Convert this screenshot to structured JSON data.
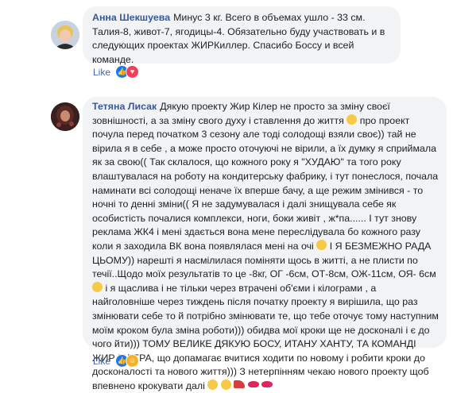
{
  "comments": [
    {
      "author": "Анна Шекшуева",
      "text": "Минус 3 кг. Всего в объемах ушло - 33 см. Талия-8, живот-7, ягодицы-4. Обязательно буду участвовать и в следующих проектах ЖИРКиллер. Спасибо Боссу и всей команде.",
      "action": "Like",
      "reactions": [
        "like",
        "love"
      ]
    },
    {
      "author": "Тетяна Лисак",
      "text_part1": "Дякую проекту Жир Кілер не просто за зміну своєї зовнішності, а за зміну свого духу і ставлення до життя",
      "text_part2": "про проект почула перед початком 3 сезону але тоді солодощі взяли своє)) тай не вірила я в себе , а може просто оточуючі не вірили, а їх думку я сприймала як за свою(( Так склалося, що кожного року я \"ХУДАЮ\" та того року влаштувалася на роботу на кондитерську фабрику, і тут понеслося, почала наминати всі солодощі неначе їх вперше бачу, а ще режим змінився - то ночні то денні зміни(( Я не задумувалася і далі знищувала себе як особистість почалися комплекси, ноги, боки живіт , ж*па...... І тут знову реклама ЖК4 і мені здається вона мене переслідувала бо кожного разу коли я заходила ВК вона появлялася мені на очі",
      "text_part3": "І Я БЕЗМЕЖНО РАДА ЦЬОМУ)) нарешті я насмілилася поміняти щось в житті, а не плисти по течії..Щодо моїх результатів то це -8кг, ОГ -6см, ОТ-8см, ОЖ-11см, ОЯ- 6см",
      "text_part4": "і я щаслива і не тільки через втрачені об'єми і кілограми , а найголовніше через тиждень після початку проекту я вирішила, що раз змінювати себе то й потрібно змінювати те, що тебе оточує тому наступним моїм кроком була зміна роботи))) обидва мої кроки ще не досконалі і є до чого йти))) ТОМУ ВЕЛИКЕ ДЯКУЮ БОСУ, ИТАНУ ХАНТУ, ТА КОМАНДІ ЖИР КІЛЕРА, що допамагає вчитися ходити по новому і робити кроки до досконалості та нового життя))) З нетерпінням чекаю нового проекту щоб впевнено крокувати далі",
      "action": "Like",
      "reactions": [
        "like",
        "haha"
      ]
    }
  ]
}
